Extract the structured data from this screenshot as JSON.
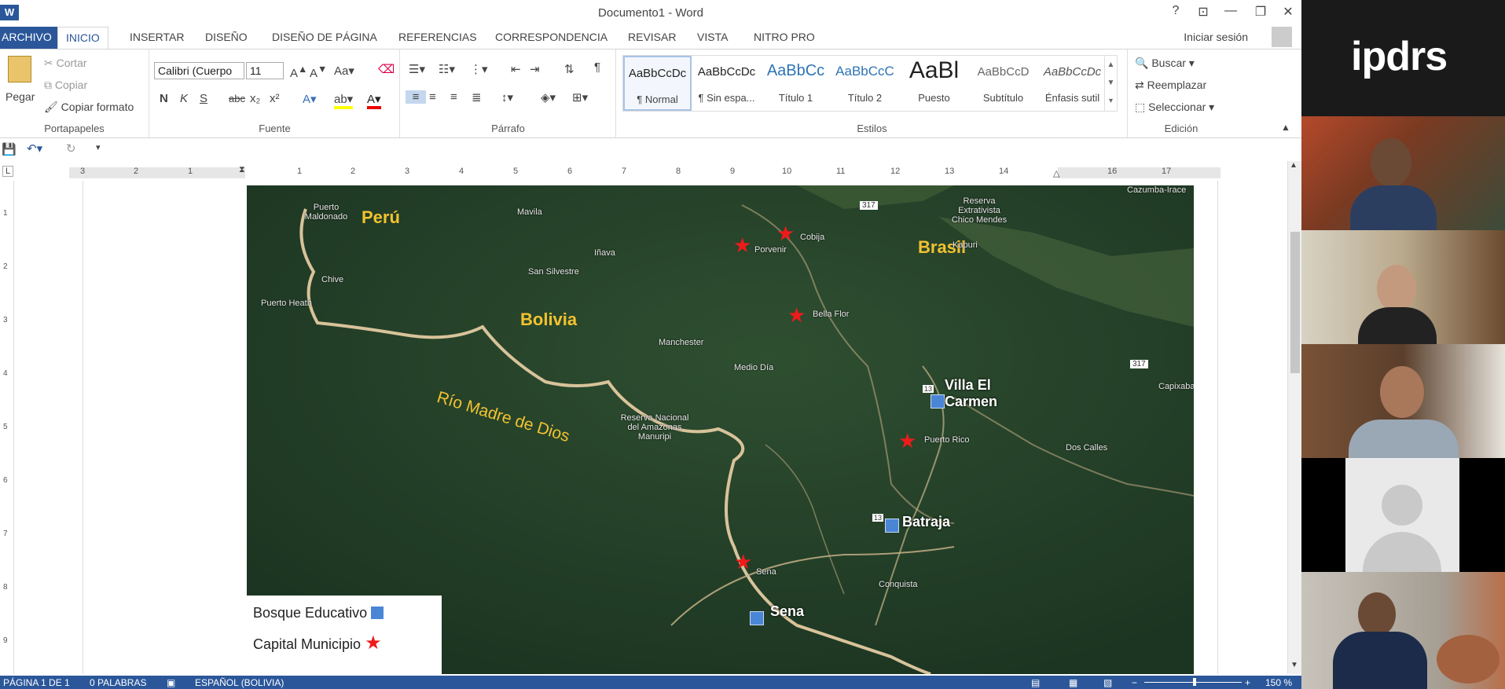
{
  "window": {
    "title": "Documento1 - Word",
    "help": "?",
    "restore_ribbon": "⊡",
    "minimize": "—",
    "maximize": "❐",
    "close": "✕"
  },
  "tabs": {
    "archivo": "ARCHIVO",
    "items": [
      "INICIO",
      "INSERTAR",
      "DISEÑO",
      "DISEÑO DE PÁGINA",
      "REFERENCIAS",
      "CORRESPONDENCIA",
      "REVISAR",
      "VISTA",
      "NITRO PRO"
    ],
    "signin": "Iniciar sesión"
  },
  "ribbon": {
    "clipboard": {
      "label": "Portapapeles",
      "paste": "Pegar",
      "cut": "Cortar",
      "copy": "Copiar",
      "format_painter": "Copiar formato"
    },
    "font": {
      "label": "Fuente",
      "name": "Calibri (Cuerpo",
      "size": "11",
      "bold": "N",
      "italic": "K",
      "underline": "S",
      "strike": "abc",
      "subscript": "x₂",
      "superscript": "x²"
    },
    "paragraph": {
      "label": "Párrafo"
    },
    "styles": {
      "label": "Estilos",
      "items": [
        {
          "preview": "AaBbCcDc",
          "name": "¶ Normal"
        },
        {
          "preview": "AaBbCcDc",
          "name": "¶ Sin espa..."
        },
        {
          "preview": "AaBbCc",
          "name": "Título 1"
        },
        {
          "preview": "AaBbCcC",
          "name": "Título 2"
        },
        {
          "preview": "AaBl",
          "name": "Puesto"
        },
        {
          "preview": "AaBbCcD",
          "name": "Subtítulo"
        },
        {
          "preview": "AaBbCcDc",
          "name": "Énfasis sutil"
        }
      ]
    },
    "editing": {
      "label": "Edición",
      "find": "Buscar",
      "replace": "Reemplazar",
      "select": "Seleccionar"
    }
  },
  "ruler": {
    "numbers": [
      "3",
      "2",
      "1",
      "1",
      "2",
      "3",
      "4",
      "5",
      "6",
      "7",
      "8",
      "9",
      "10",
      "11",
      "12",
      "13",
      "14",
      "16",
      "17"
    ]
  },
  "vruler": {
    "numbers": [
      "1",
      "2",
      "3",
      "4",
      "5",
      "6",
      "7",
      "8",
      "9"
    ]
  },
  "map": {
    "countries": [
      "Perú",
      "Brasil",
      "Bolivia"
    ],
    "river": "Río Madre de Dios",
    "places": [
      "Puerto Maldonado",
      "Mavila",
      "Iñava",
      "San Silvestre",
      "Chive",
      "Puerto Heath",
      "Manchester",
      "Medio Día",
      "Reserva Nacional del Amazonas Manuripi",
      "Reserva Extrativista Chico Mendes",
      "Kapuri",
      "Cobija",
      "Porvenir",
      "Bella Flor",
      "Puerto Rico",
      "Dos Calles",
      "Capixaba",
      "Conquista",
      "Sena",
      "Cazumba-Irace"
    ],
    "roads": [
      "317",
      "317",
      "13",
      "13"
    ],
    "forests": [
      "Villa El Carmen",
      "Batraja",
      "Sena"
    ],
    "legend": {
      "forest": "Bosque Educativo",
      "capital": "Capital Municipio"
    },
    "colors": {
      "star": "#ee1b1b",
      "forest": "#4a86d6",
      "country": "#f2c230"
    }
  },
  "status": {
    "page": "PÁGINA 1 DE 1",
    "words": "0 PALABRAS",
    "lang": "ESPAÑOL (BOLIVIA)",
    "zoom": "150 %"
  },
  "side": {
    "logo": "ipdrs"
  }
}
